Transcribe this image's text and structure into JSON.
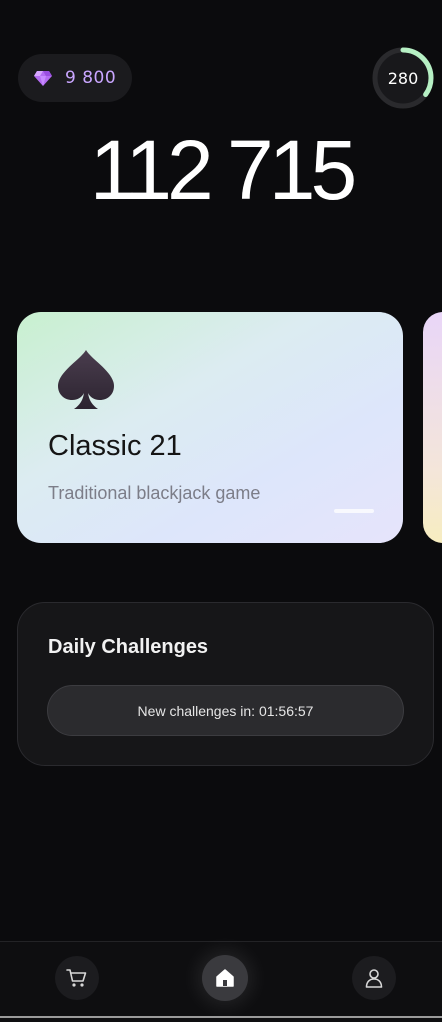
{
  "header": {
    "gems": "9 800",
    "level": "280",
    "level_progress": 0.35
  },
  "balance": "112 715",
  "game_card": {
    "title": "Classic 21",
    "subtitle": "Traditional blackjack game",
    "icon": "spade-icon"
  },
  "challenges": {
    "title": "Daily Challenges",
    "timer_text": "New challenges in: 01:56:57"
  },
  "nav": {
    "items": [
      {
        "icon": "cart-icon",
        "active": false
      },
      {
        "icon": "home-icon",
        "active": true
      },
      {
        "icon": "profile-icon",
        "active": false
      }
    ]
  },
  "colors": {
    "background": "#0b0b0d",
    "gem_accent": "#c9a6ff",
    "level_ring": "#b6f0c4"
  }
}
